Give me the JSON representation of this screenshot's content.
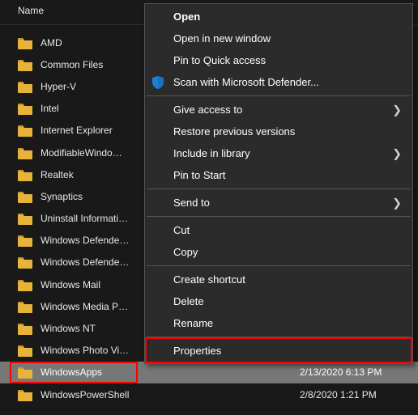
{
  "header": {
    "name_col": "Name"
  },
  "folders": [
    {
      "label": "AMD"
    },
    {
      "label": "Common Files"
    },
    {
      "label": "Hyper-V"
    },
    {
      "label": "Intel"
    },
    {
      "label": "Internet Explorer"
    },
    {
      "label": "ModifiableWindo…"
    },
    {
      "label": "Realtek"
    },
    {
      "label": "Synaptics"
    },
    {
      "label": "Uninstall Informati…"
    },
    {
      "label": "Windows Defende…"
    },
    {
      "label": "Windows Defende…"
    },
    {
      "label": "Windows Mail"
    },
    {
      "label": "Windows Media P…"
    },
    {
      "label": "Windows NT"
    },
    {
      "label": "Windows Photo Vi…"
    },
    {
      "label": "WindowsApps",
      "selected": true,
      "date": "2/13/2020 6:13 PM",
      "highlighted": true
    },
    {
      "label": "WindowsPowerShell",
      "date": "2/8/2020 1:21 PM"
    }
  ],
  "ctx": {
    "open": "Open",
    "open_new_window": "Open in new window",
    "pin_quick_access": "Pin to Quick access",
    "scan_defender": "Scan with Microsoft Defender...",
    "give_access": "Give access to",
    "restore_prev": "Restore previous versions",
    "include_library": "Include in library",
    "pin_start": "Pin to Start",
    "send_to": "Send to",
    "cut": "Cut",
    "copy": "Copy",
    "create_shortcut": "Create shortcut",
    "delete": "Delete",
    "rename": "Rename",
    "properties": "Properties"
  }
}
